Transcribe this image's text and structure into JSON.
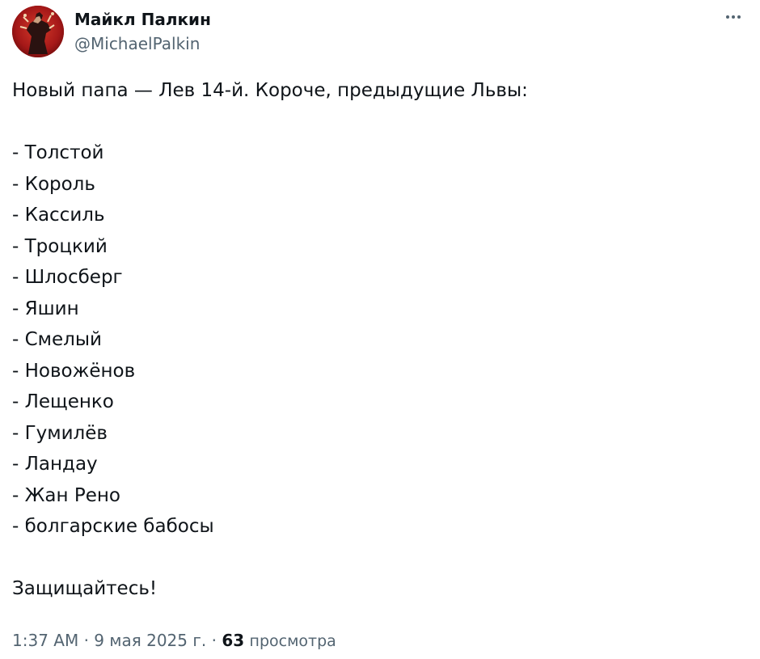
{
  "author": {
    "display_name": "Майкл Палкин",
    "handle": "@MichaelPalkin",
    "avatar_icon": "avatar-figure-icon"
  },
  "more_icon": "more-options-icon",
  "tweet": {
    "intro": "Новый папа — Лев 14-й. Короче, предыдущие Львы:",
    "list": [
      "- Толстой",
      "- Король",
      "- Кассиль",
      "- Троцкий",
      "- Шлосберг",
      "- Яшин",
      "- Смелый",
      "- Новожёнов",
      "- Лещенко",
      "- Гумилёв",
      "- Ландау",
      "- Жан Рено",
      "- болгарские бабосы"
    ],
    "outro": "Защищайтесь!"
  },
  "footer": {
    "time": "1:37 AM",
    "sep1": "·",
    "date": "9 мая 2025 г.",
    "sep2": "·",
    "views_count": "63",
    "views_label": "просмотра"
  },
  "colors": {
    "text": "#0f1419",
    "secondary": "#536471",
    "avatar_bg": "#b31c1c"
  }
}
